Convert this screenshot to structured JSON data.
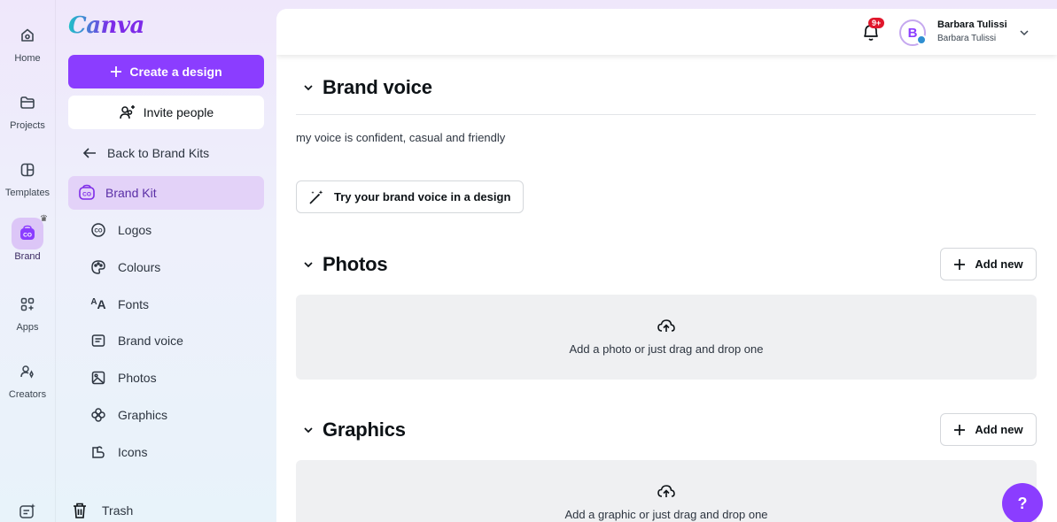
{
  "rail": {
    "items": [
      {
        "label": "Home",
        "icon": "home-icon"
      },
      {
        "label": "Projects",
        "icon": "folder-icon"
      },
      {
        "label": "Templates",
        "icon": "templates-icon"
      },
      {
        "label": "Brand",
        "icon": "brand-icon",
        "active": true
      },
      {
        "label": "Apps",
        "icon": "apps-icon"
      },
      {
        "label": "Creators",
        "icon": "creators-icon"
      }
    ],
    "bottom_icon": "magic-icon"
  },
  "sidebar": {
    "logo": "Canva",
    "create_label": "Create a design",
    "invite_label": "Invite people",
    "back_label": "Back to Brand Kits",
    "brand_kit_label": "Brand Kit",
    "items": [
      {
        "label": "Logos",
        "icon": "logos-icon"
      },
      {
        "label": "Colours",
        "icon": "palette-icon"
      },
      {
        "label": "Fonts",
        "icon": "fonts-icon"
      },
      {
        "label": "Brand voice",
        "icon": "text-box-icon"
      },
      {
        "label": "Photos",
        "icon": "image-icon"
      },
      {
        "label": "Graphics",
        "icon": "graphics-icon"
      },
      {
        "label": "Icons",
        "icon": "icons-icon"
      }
    ],
    "trash_label": "Trash"
  },
  "header": {
    "notification_badge": "9+",
    "avatar_letter": "B",
    "user_name": "Barbara Tulissi",
    "user_team": "Barbara Tulissi"
  },
  "main": {
    "brand_voice": {
      "title": "Brand voice",
      "text": "my voice is confident, casual and friendly",
      "try_label": "Try your brand voice in a design"
    },
    "photos": {
      "title": "Photos",
      "add_label": "Add new",
      "drop_text": "Add a photo or just drag and drop one"
    },
    "graphics": {
      "title": "Graphics",
      "add_label": "Add new",
      "drop_text": "Add a graphic or just drag and drop one"
    }
  },
  "help_label": "?",
  "colors": {
    "accent": "#8b3dff",
    "active_bg": "#e3d2f8",
    "badge": "#e0162b"
  }
}
